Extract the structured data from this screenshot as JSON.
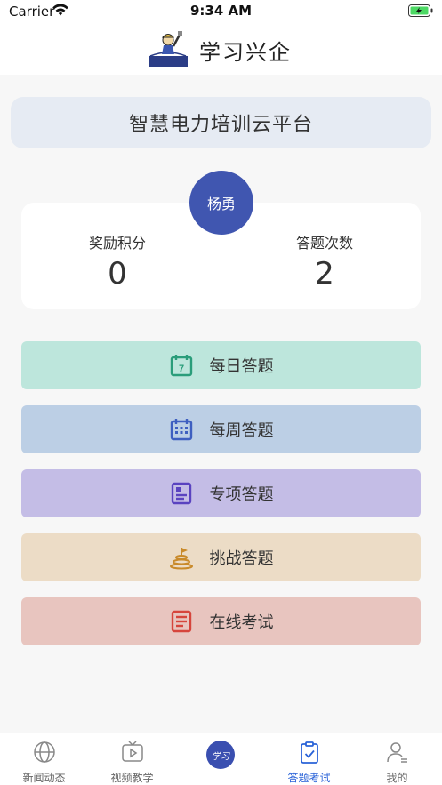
{
  "status_bar": {
    "carrier": "Carrier",
    "time": "9:34 AM"
  },
  "header": {
    "title": "学习兴企"
  },
  "platform": {
    "title": "智慧电力培训云平台"
  },
  "user": {
    "name": "杨勇"
  },
  "stats": {
    "points_label": "奖励积分",
    "points_value": "0",
    "count_label": "答题次数",
    "count_value": "2"
  },
  "menu": [
    {
      "label": "每日答题",
      "icon": "calendar-7-icon",
      "bg": "#bde6dc",
      "color": "#2a9d7a"
    },
    {
      "label": "每周答题",
      "icon": "calendar-grid-icon",
      "bg": "#bccfe5",
      "color": "#3e5fc0"
    },
    {
      "label": "专项答题",
      "icon": "document-icon",
      "bg": "#c4bde6",
      "color": "#5a43c0"
    },
    {
      "label": "挑战答题",
      "icon": "flag-mountain-icon",
      "bg": "#ecdcc6",
      "color": "#c98a2a"
    },
    {
      "label": "在线考试",
      "icon": "list-document-icon",
      "bg": "#e8c5bf",
      "color": "#d6453c"
    }
  ],
  "tabbar": {
    "tabs": [
      {
        "label": "新闻动态",
        "icon": "globe-icon"
      },
      {
        "label": "视频教学",
        "icon": "video-icon"
      },
      {
        "label": "",
        "icon": "center-logo-icon"
      },
      {
        "label": "答题考试",
        "icon": "clipboard-check-icon"
      },
      {
        "label": "我的",
        "icon": "person-icon"
      }
    ],
    "center_badge": "学习",
    "active_color": "#2a63d8"
  }
}
